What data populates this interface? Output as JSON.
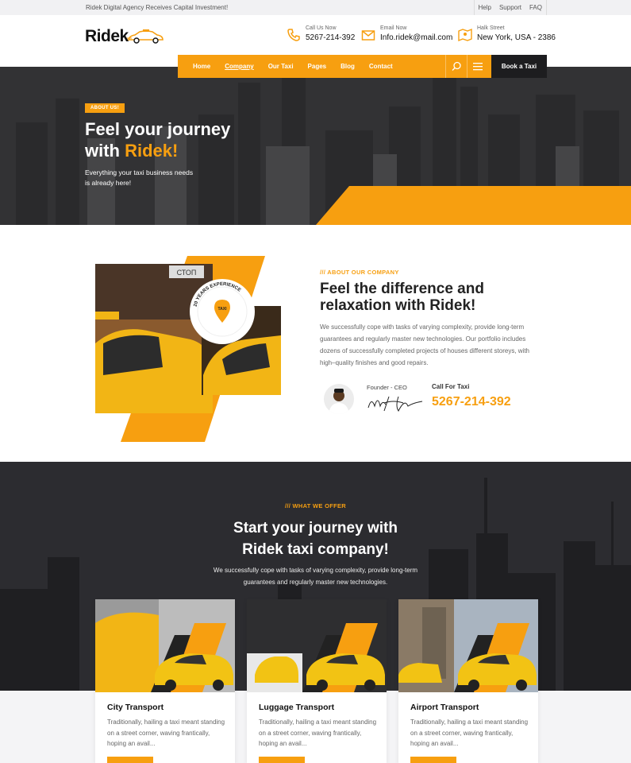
{
  "topbar": {
    "news": "Ridek Digital Agency Receives Capital Investment!",
    "links": [
      "Help",
      "Support",
      "FAQ"
    ]
  },
  "header": {
    "logo": "Ridek",
    "phone": {
      "label": "Call Us Now",
      "value": "5267-214-392",
      "icon": "phone-icon"
    },
    "email": {
      "label": "Email Now",
      "value": "Info.ridek@mail.com",
      "icon": "mail-icon"
    },
    "address": {
      "label": "Halk Street",
      "value": "New York, USA - 2386",
      "icon": "map-icon"
    }
  },
  "nav": {
    "items": [
      "Home",
      "Company",
      "Our Taxi",
      "Pages",
      "Blog",
      "Contact"
    ],
    "active": "Company",
    "book_label": "Book a Taxi"
  },
  "hero": {
    "badge": "ABOUT US!",
    "title_line1": "Feel your journey",
    "title_prefix": "with ",
    "title_highlight": "Ridek!",
    "subtitle": "Everything your taxi business needs is already here!"
  },
  "about": {
    "eyebrow": "/// ABOUT OUR COMPANY",
    "title": "Feel the difference and relaxation with Ridek!",
    "description": "We successfully cope with tasks of varying complexity, provide long-term guarantees and regularly master new technologies. Our portfolio includes dozens of successfully completed projects of houses different storeys, with high–quality finishes and good repairs.",
    "founder_label": "Founder - CEO",
    "signature": "Mike Hardson",
    "call_label": "Call For Taxi",
    "call_number": "5267-214-392",
    "seal_text": "20 YEARS EXPERIENCE",
    "sign_text": "СТОП",
    "taxi_text": "TAXI"
  },
  "offer": {
    "eyebrow": "/// WHAT WE OFFER",
    "title_line1": "Start your journey with",
    "title_line2": "Ridek taxi company!",
    "subtitle": "We successfully cope with tasks of varying complexity, provide long-term guarantees and regularly master new technologies.",
    "cards": [
      {
        "title": "City Transport",
        "text": "Traditionally, hailing a taxi meant standing on a street corner, waving frantically, hoping an avail..."
      },
      {
        "title": "Luggage Transport",
        "text": "Traditionally, hailing a taxi meant standing on a street corner, waving frantically, hoping an avail..."
      },
      {
        "title": "Airport Transport",
        "text": "Traditionally, hailing a taxi meant standing on a street corner, waving frantically, hoping an avail..."
      }
    ]
  },
  "colors": {
    "accent": "#f79f10",
    "dark": "#1d1d1f"
  }
}
